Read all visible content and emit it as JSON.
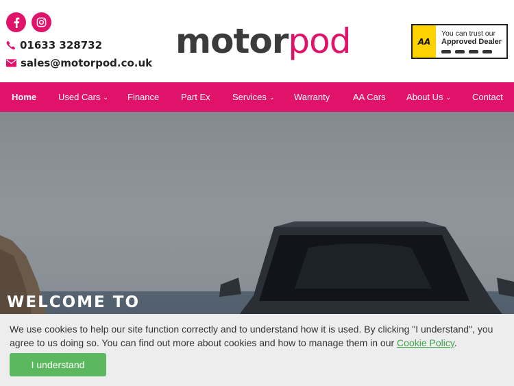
{
  "header": {
    "phone": "01633 328732",
    "email": "sales@motorpod.co.uk",
    "social": [
      {
        "icon": "facebook-icon"
      },
      {
        "icon": "instagram-icon"
      }
    ],
    "logo": {
      "part1": "motor",
      "part2": "pod"
    },
    "aa_badge": {
      "logo": "AA",
      "line1": "You can trust our",
      "line2": "Approved Dealer"
    }
  },
  "nav": {
    "items": [
      {
        "label": "Home",
        "active": true
      },
      {
        "label": "Used Cars",
        "dropdown": true
      },
      {
        "label": "Finance"
      },
      {
        "label": "Part Ex"
      },
      {
        "label": "Services",
        "dropdown": true
      },
      {
        "label": "Warranty"
      },
      {
        "label": "AA Cars"
      },
      {
        "label": "About Us",
        "dropdown": true
      },
      {
        "label": "Contact"
      }
    ]
  },
  "hero": {
    "heading": "WELCOME TO"
  },
  "cookie": {
    "text": "We use cookies to help our site function correctly and to understand how it is used. By clicking \"I understand\", you agree to us doing so. You can find out more about cookies and how to manage them in our ",
    "link": "Cookie Policy",
    "end": ".",
    "button": "I understand"
  },
  "colors": {
    "brand": "#e0126a",
    "accept_button": "#5bb85f",
    "link": "#3fa34d"
  }
}
